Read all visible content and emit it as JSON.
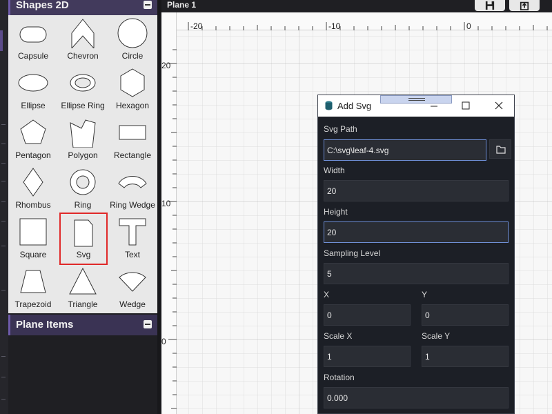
{
  "shapes_panel": {
    "title": "Shapes 2D",
    "items": [
      {
        "label": "Capsule",
        "icon": "capsule-icon"
      },
      {
        "label": "Chevron",
        "icon": "chevron-icon"
      },
      {
        "label": "Circle",
        "icon": "circle-icon"
      },
      {
        "label": "Ellipse",
        "icon": "ellipse-icon"
      },
      {
        "label": "Ellipse Ring",
        "icon": "ellipse-ring-icon"
      },
      {
        "label": "Hexagon",
        "icon": "hexagon-icon"
      },
      {
        "label": "Pentagon",
        "icon": "pentagon-icon"
      },
      {
        "label": "Polygon",
        "icon": "polygon-icon"
      },
      {
        "label": "Rectangle",
        "icon": "rectangle-icon"
      },
      {
        "label": "Rhombus",
        "icon": "rhombus-icon"
      },
      {
        "label": "Ring",
        "icon": "ring-icon"
      },
      {
        "label": "Ring Wedge",
        "icon": "ring-wedge-icon"
      },
      {
        "label": "Square",
        "icon": "square-icon"
      },
      {
        "label": "Svg",
        "icon": "svg-file-icon",
        "selected": true
      },
      {
        "label": "Text",
        "icon": "text-t-icon"
      },
      {
        "label": "Trapezoid",
        "icon": "trapezoid-icon"
      },
      {
        "label": "Triangle",
        "icon": "triangle-icon"
      },
      {
        "label": "Wedge",
        "icon": "wedge-icon"
      }
    ]
  },
  "plane_items_panel": {
    "title": "Plane Items"
  },
  "canvas": {
    "tab_title": "Plane 1",
    "ruler_x_labels": [
      "-20",
      "-10",
      "0"
    ],
    "ruler_y_labels": [
      "20",
      "10",
      "0"
    ]
  },
  "dialog": {
    "title": "Add Svg",
    "fields": {
      "svg_path": {
        "label": "Svg Path",
        "value": "C:\\svg\\leaf-4.svg"
      },
      "width": {
        "label": "Width",
        "value": "20"
      },
      "height": {
        "label": "Height",
        "value": "20"
      },
      "sampling_level": {
        "label": "Sampling Level",
        "value": "5"
      },
      "x": {
        "label": "X",
        "value": "0"
      },
      "y": {
        "label": "Y",
        "value": "0"
      },
      "scale_x": {
        "label": "Scale X",
        "value": "1"
      },
      "scale_y": {
        "label": "Scale Y",
        "value": "1"
      },
      "rotation": {
        "label": "Rotation",
        "value": "0.000"
      }
    }
  },
  "colors": {
    "panel_header": "#423a5c",
    "panel_accent": "#6d5aa8",
    "selected_outline": "#e02828",
    "dialog_bg": "#1c1f26",
    "focus_border": "#6f8fd6"
  }
}
